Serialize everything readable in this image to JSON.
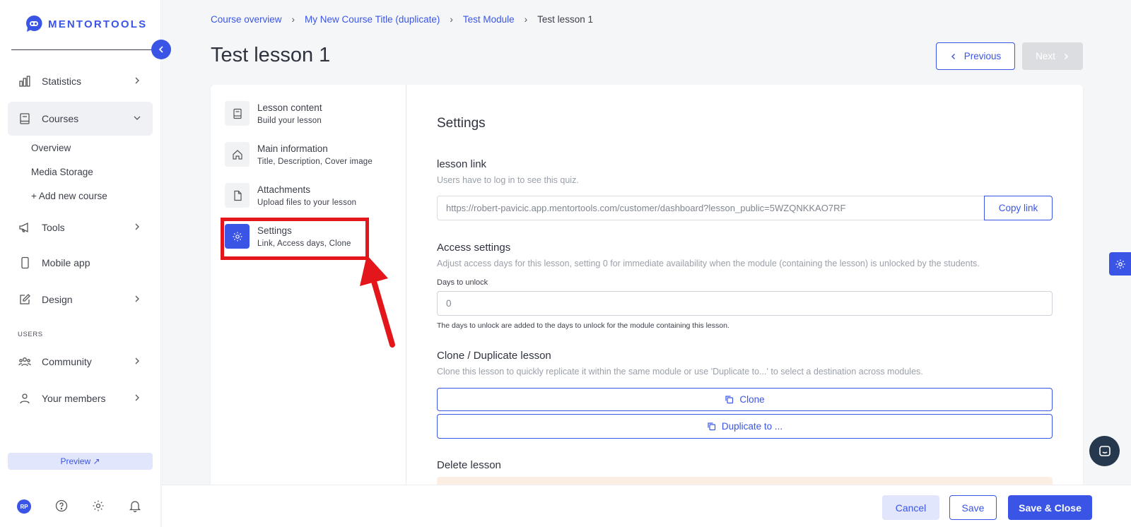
{
  "brand": {
    "name": "MENTORTOOLS",
    "accent": "#3a55e6"
  },
  "sidebar": {
    "items": [
      {
        "label": "Statistics",
        "icon": "bar-chart-icon"
      },
      {
        "label": "Courses",
        "icon": "book-icon"
      },
      {
        "label": "Tools",
        "icon": "megaphone-icon"
      },
      {
        "label": "Mobile app",
        "icon": "phone-icon"
      },
      {
        "label": "Design",
        "icon": "pencil-icon"
      },
      {
        "label": "Community",
        "icon": "people-icon"
      },
      {
        "label": "Your members",
        "icon": "user-icon"
      }
    ],
    "course_sub": [
      "Overview",
      "Media Storage",
      "+ Add new course"
    ],
    "section_users": "USERS",
    "preview_label": "Preview ↗",
    "avatar_initials": "RP"
  },
  "breadcrumb": [
    "Course overview",
    "My New Course Title (duplicate)",
    "Test Module",
    "Test lesson 1"
  ],
  "page_title": "Test lesson 1",
  "nav_buttons": {
    "previous": "Previous",
    "next": "Next"
  },
  "lesson_menu": [
    {
      "title": "Lesson content",
      "subtitle": "Build your lesson",
      "icon": "book-icon"
    },
    {
      "title": "Main information",
      "subtitle": "Title, Description, Cover image",
      "icon": "home-icon"
    },
    {
      "title": "Attachments",
      "subtitle": "Upload files to your lesson",
      "icon": "file-icon"
    },
    {
      "title": "Settings",
      "subtitle": "Link, Access days, Clone",
      "icon": "gear-icon"
    }
  ],
  "settings": {
    "heading": "Settings",
    "link": {
      "title": "lesson link",
      "desc": "Users have to log in to see this quiz.",
      "url": "https://robert-pavicic.app.mentortools.com/customer/dashboard?lesson_public=5WZQNKKAO7RF",
      "copy_label": "Copy link"
    },
    "access": {
      "title": "Access settings",
      "desc": "Adjust access days for this lesson, setting 0 for immediate availability when the module (containing the lesson) is unlocked by the students.",
      "field_label": "Days to unlock",
      "field_value": "0",
      "hint": "The days to unlock are added to the days to unlock for the module containing this lesson."
    },
    "clone": {
      "title": "Clone / Duplicate lesson",
      "desc": "Clone this lesson to quickly replicate it within the same module or use 'Duplicate to...' to select a destination across modules.",
      "clone_label": "Clone",
      "duplicate_label": "Duplicate to ..."
    },
    "delete": {
      "title": "Delete lesson"
    }
  },
  "footer": {
    "cancel": "Cancel",
    "save": "Save",
    "save_close": "Save & Close"
  },
  "annotation": {
    "color": "#e3161b"
  }
}
